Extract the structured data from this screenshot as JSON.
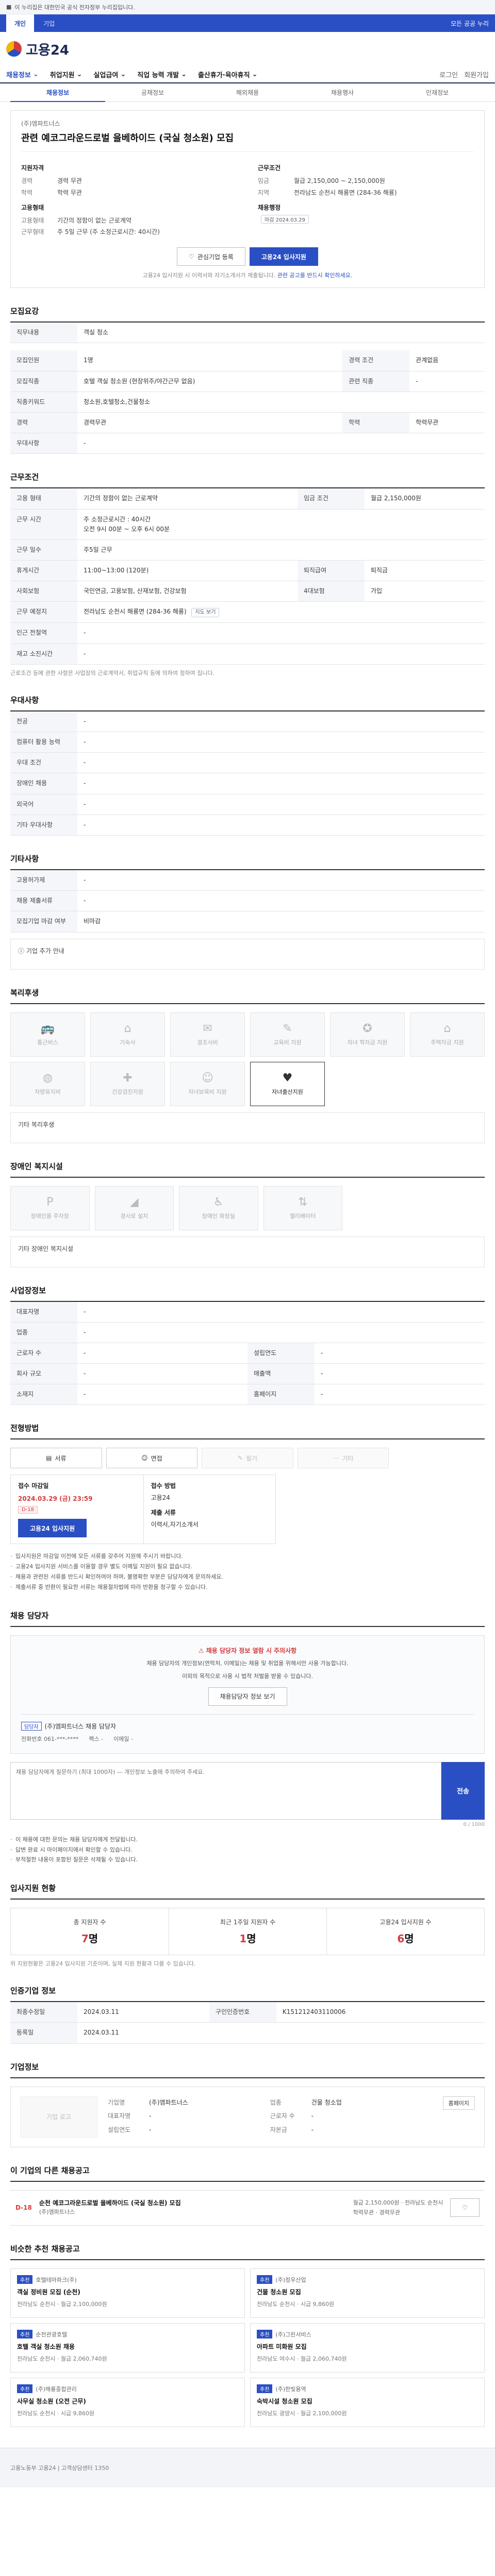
{
  "gov_banner": {
    "text": "이 누리집은 대한민국 공식 전자정부 누리집입니다."
  },
  "util": {
    "tabs": [
      "개인",
      "기업"
    ],
    "right": "모든 공공 누리"
  },
  "logo": {
    "text": "고용24"
  },
  "gnb": {
    "items": [
      "채용정보",
      "취업지원",
      "실업급여",
      "직업 능력 개발",
      "출산휴가·육아휴직"
    ],
    "right": [
      "로그인",
      "회원가입"
    ]
  },
  "lnb": {
    "items": [
      "채용정보",
      "공채정보",
      "해외채용",
      "채용행사",
      "인재정보"
    ]
  },
  "job": {
    "company": "(주)엠파트너스",
    "title": "관련 예코그라운드로벌 을베하이드 (국실 청소원) 모집",
    "left_h": "지원자격",
    "left_rows": [
      [
        "경력",
        "경력 무관"
      ],
      [
        "학력",
        "학력 무관"
      ]
    ],
    "left_h2": "고용형태",
    "left_rows2": [
      [
        "고용형태",
        "기간의 정함이 없는 근로계약"
      ],
      [
        "근무형태",
        "주 5일 근무 (주 소정근로시간: 40시간)"
      ]
    ],
    "right_h": "근무조건",
    "right_rows": [
      [
        "임금",
        "월급 2,150,000 ~ 2,150,000원"
      ],
      [
        "지역",
        "전라남도 순천시 해룡면 (284-36 해룡)"
      ]
    ],
    "right_h2": "채용행정",
    "right_badge": "마감 2024.03.29",
    "btn_interest": "관심기업 등록",
    "btn_apply": "고용24 입사지원",
    "notice": "고용24 입사지원 시 이력서와 자기소개서가 제출됩니다.",
    "notice_hl": "관련 공고를 반드시 확인하세요."
  },
  "sec_recruit": {
    "title": "모집요강",
    "rows": [
      [
        "직무내용",
        "객실 청소"
      ]
    ]
  },
  "sec_recruit2": {
    "rows": [
      [
        "모집인원",
        "1명",
        "경력 조건",
        "관계없음"
      ],
      [
        "모집직종",
        "호텔 객실 청소원 (현장위주/야간근무 없음)",
        "관련 직종",
        "-"
      ],
      [
        "직종키워드",
        "청소원,호텔청소,건물청소",
        "",
        ""
      ],
      [
        "경력",
        "경력무관",
        "학력",
        "학력무관"
      ],
      [
        "우대사항",
        "-",
        "",
        ""
      ]
    ]
  },
  "sec_work": {
    "title": "근무조건",
    "rows": [
      [
        "고용 형태",
        "기간의 정함이 없는 근로계약",
        "임금 조건",
        "월급 2,150,000원"
      ],
      [
        "근무 시간",
        "주 소정근로시간 : 40시간",
        "",
        ""
      ],
      [
        "근무 일수",
        "주5일 근무",
        "",
        ""
      ],
      [
        "휴게시간",
        "11:00~13:00 (120분)",
        "퇴직급여",
        "퇴직금"
      ],
      [
        "사회보험",
        "국민연금, 고용보험, 산재보험, 건강보험",
        "4대보험",
        "가입"
      ],
      [
        "근무 예정지",
        "전라남도 순천시 해룡면 (284-36 해룡)",
        "",
        ""
      ],
      [
        "인근 전철역",
        "-",
        "",
        ""
      ],
      [
        "재고 소진시간",
        "-",
        "",
        ""
      ]
    ],
    "work_time": "오전 9시 00분 ~ 오후 6시 00분",
    "note": "근로조건 등에 관한 사항은 사업장의 근로계약서, 취업규칙 등에 의하여 정하여 집니다."
  },
  "sec_prefer": {
    "title": "우대사항",
    "rows": [
      [
        "전공",
        "-"
      ],
      [
        "컴퓨터 활용 능력",
        "-"
      ],
      [
        "우대 조건",
        "-"
      ],
      [
        "장애인 채용",
        "-"
      ],
      [
        "외국어",
        "-"
      ],
      [
        "기타 우대사항",
        "-"
      ]
    ]
  },
  "sec_etc": {
    "title": "기타사항",
    "rows": [
      [
        "고용허가제",
        "-"
      ],
      [
        "채용 제출서류",
        "-"
      ],
      [
        "모집기업 마감 여부",
        "비마감"
      ]
    ],
    "more": "기업 추가 안내"
  },
  "sec_welfare": {
    "title": "복리후생",
    "items": [
      "통근버스",
      "기숙사",
      "경조사비",
      "교육비 지원",
      "자녀 학자금 지원",
      "주택자금 지원",
      "차량유지비",
      "건강검진지원",
      "자녀보육비 지원",
      "자녀출산지원"
    ],
    "etc": "기타 복리후생"
  },
  "sec_disabled": {
    "title": "장애인 복지시설",
    "items": [
      "장애인용 주차장",
      "경사로 설치",
      "장애인 화장실",
      "엘리베이터"
    ],
    "etc": "기타 장애인 복지시설"
  },
  "sec_company_info": {
    "title": "사업장정보",
    "rows": [
      [
        "대표자명",
        "-",
        "",
        ""
      ],
      [
        "업종",
        "-",
        "",
        ""
      ],
      [
        "근로자 수",
        "-",
        "설립연도",
        "-"
      ],
      [
        "회사 규모",
        "-",
        "매출액",
        "-"
      ],
      [
        "소재지",
        "-",
        "홈페이지",
        "-"
      ]
    ]
  },
  "sec_apply": {
    "title": "전형방법",
    "methods": [
      "서류",
      "면접",
      "필기",
      "기타"
    ],
    "deadline_label": "접수 마감일",
    "deadline_date": "2024.03.29 (금) 23:59",
    "dday": "D-18",
    "apply_btn": "고용24 입사지원",
    "method_label": "접수 방법",
    "method_val": "고용24",
    "docs_label": "제출 서류",
    "docs_val": "이력서,자기소개서",
    "bullets": [
      "입사지원은 마감일 이전에 모든 서류를 갖추어 지원해 주시기 바랍니다.",
      "고용24 입사지원 서비스를 이용할 경우 별도 이메일 지원이 필요 없습니다.",
      "채용과 관련된 서류를 반드시 확인하여야 하며, 불명확한 부분은 담당자에게 문의하세요.",
      "제출서류 중 반환이 필요한 서류는 채용절차법에 따라 반환을 청구할 수 있습니다."
    ]
  },
  "sec_contact": {
    "title": "채용 담당자",
    "warn": "채용 담당자 정보 열람 시 주의사항",
    "p1": "채용 담당자의 개인정보(연락처, 이메일)는 채용 및 취업을 위해서만 사용 가능합니다.",
    "p2": "이외의 목적으로 사용 시 법적 처벌을 받을 수 있습니다.",
    "show_btn": "채용담당자 정보 보기",
    "tag": "담당자",
    "name": "(주)엠파트너스 채용 담당자",
    "phone_label": "전화번호",
    "phone": "061-***-****",
    "fax_label": "팩스",
    "fax": "-",
    "email_label": "이메일",
    "email": "-"
  },
  "sec_qa": {
    "placeholder": "채용 담당자에게 질문하기 (최대 1000자) — 개인정보 노출에 주의하여 주세요.",
    "send": "전송",
    "counter": "0 / 1000",
    "bullets": [
      "이 채용에 대한 문의는 채용 담당자에게 전달됩니다.",
      "답변 완료 시 마이페이지에서 확인할 수 있습니다.",
      "부적절한 내용이 포함된 질문은 삭제될 수 있습니다."
    ]
  },
  "sec_stats": {
    "title": "입사지원 현황",
    "items": [
      {
        "label": "총 지원자 수",
        "num": "7",
        "unit": "명"
      },
      {
        "label": "최근 1주일 지원자 수",
        "num": "1",
        "unit": "명"
      },
      {
        "label": "고용24 입사지원 수",
        "num": "6",
        "unit": "명"
      }
    ],
    "note": "위 지원현황은 고용24 입사지원 기준이며, 실제 지원 현황과 다를 수 있습니다."
  },
  "sec_meta": {
    "title": "인증기업 정보",
    "rows": [
      [
        "최종수정일",
        "2024.03.11",
        "구인인증번호",
        "K151212403110006"
      ],
      [
        "등록일",
        "2024.03.11",
        "",
        ""
      ]
    ]
  },
  "sec_company": {
    "title": "기업정보",
    "logo": "기업 로고",
    "fields": [
      [
        "기업명",
        "(주)엠파트너스"
      ],
      [
        "업종",
        "건물 청소업"
      ],
      [
        "대표자명",
        "-"
      ],
      [
        "근로자 수",
        "-"
      ],
      [
        "설립연도",
        "-"
      ],
      [
        "자본금",
        "-"
      ]
    ],
    "home_btn": "홈페이지"
  },
  "sec_other": {
    "title": "이 기업의 다른 채용공고",
    "dday": "D-18",
    "ttl": "순천 예코그라운드로벌 을베하이드 (국실 청소원) 모집",
    "meta1": "(주)엠파트너스",
    "meta2": "월급 2,150,000원 · 전라남도 순천시",
    "meta3": "학력무관 · 경력무관"
  },
  "sec_reco": {
    "title": "비슷한 추천 채용공고",
    "items": [
      {
        "tag": "추천",
        "co": "호텔테마파크(주)",
        "t": "객실 정비원 모집 (순천)",
        "m": "전라남도 순천시 · 월급 2,100,000원"
      },
      {
        "tag": "추천",
        "co": "(주)정우산업",
        "t": "건물 청소원 모집",
        "m": "전라남도 순천시 · 시급 9,860원"
      },
      {
        "tag": "추천",
        "co": "순천관광호텔",
        "t": "호텔 객실 청소원 채용",
        "m": "전라남도 순천시 · 월급 2,060,740원"
      },
      {
        "tag": "추천",
        "co": "(주)그린서비스",
        "t": "아파트 미화원 모집",
        "m": "전라남도 여수시 · 월급 2,060,740원"
      },
      {
        "tag": "추천",
        "co": "(주)해룡종합관리",
        "t": "사무실 청소원 (오전 근무)",
        "m": "전라남도 순천시 · 시급 9,860원"
      },
      {
        "tag": "추천",
        "co": "(주)한빛용역",
        "t": "숙박시설 청소원 모집",
        "m": "전라남도 광양시 · 월급 2,100,000원"
      }
    ]
  },
  "footer": {
    "text": "고용노동부 고용24  |  고객상담센터 1350"
  }
}
